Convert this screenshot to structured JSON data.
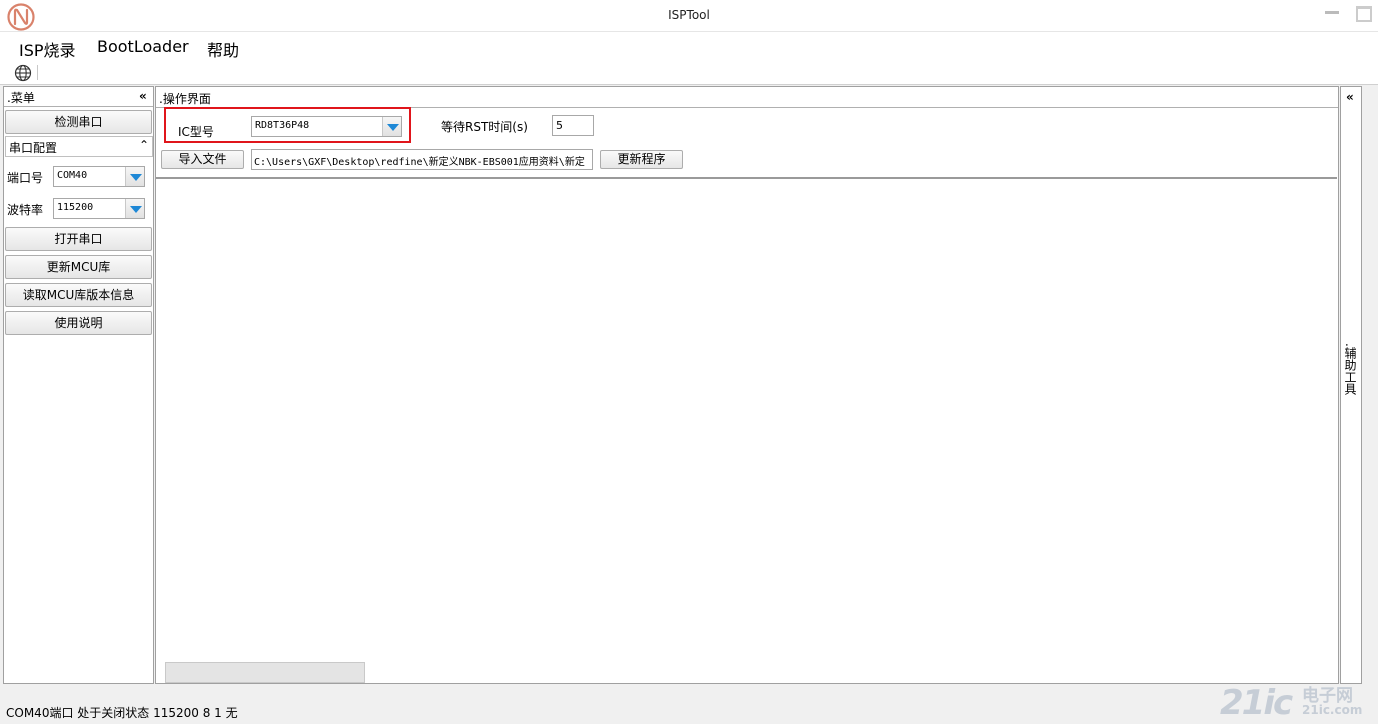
{
  "window": {
    "title": "ISPTool"
  },
  "menu": {
    "isp": "ISP烧录",
    "bootloader": "BootLoader",
    "help": "帮助"
  },
  "left_panel": {
    "title": ".菜单",
    "collapse_glyph": "«",
    "detect_port": "检测串口",
    "serial_config": {
      "title": "串口配置",
      "toggle_glyph": "⌃"
    },
    "port_label": "端口号",
    "port_value": "COM40",
    "baud_label": "波特率",
    "baud_value": "115200",
    "open_port": "打开串口",
    "update_mcu_lib": "更新MCU库",
    "read_mcu_version": "读取MCU库版本信息",
    "usage": "使用说明"
  },
  "main_panel": {
    "title": ".操作界面",
    "ic_label": "IC型号",
    "ic_value": "RD8T36P48",
    "wait_label": "等待RST时间(s)",
    "wait_value": "5",
    "import_file": "导入文件",
    "file_path": "C:\\Users\\GXF\\Desktop\\redfine\\新定义NBK-EBS001应用资料\\新定",
    "update_program": "更新程序"
  },
  "right_panel": {
    "collapse_glyph": "«",
    "title": ".辅助工具"
  },
  "status": {
    "text": "COM40端口 处于关闭状态 115200 8 1 无"
  },
  "watermark": {
    "number": "21ic",
    "chinese": "电子网",
    "url": "21ic.com"
  },
  "colors": {
    "highlight": "#e0151b",
    "combo_arrow": "#1e88d6",
    "logo": "#d9826b"
  }
}
